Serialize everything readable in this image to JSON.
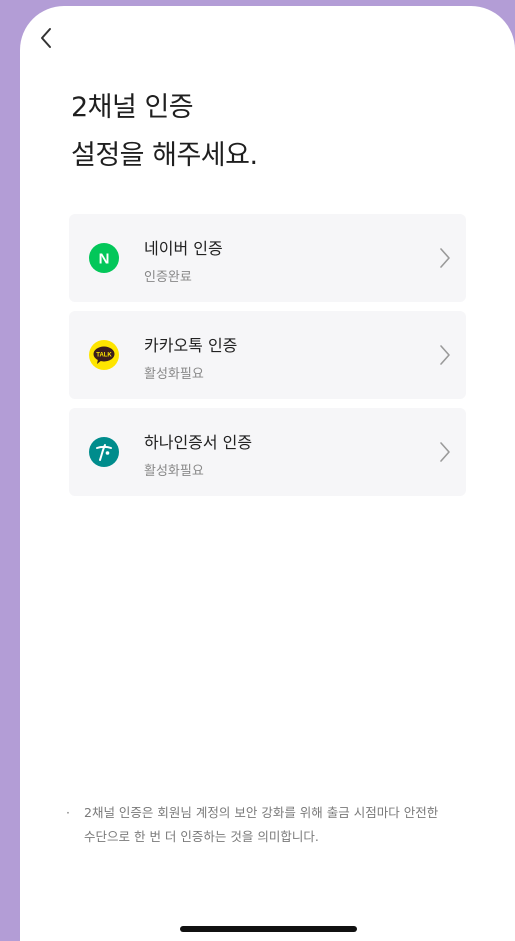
{
  "header": {
    "back_icon": "chevron-left-icon",
    "title_line1": "2채널 인증",
    "title_line2": "설정을 해주세요."
  },
  "auth_methods": [
    {
      "title": "네이버 인증",
      "status": "인증완료",
      "icon": "naver-icon",
      "icon_letter": "N",
      "icon_color": "#03c75a"
    },
    {
      "title": "카카오톡 인증",
      "status": "활성화필요",
      "icon": "kakaotalk-icon",
      "icon_letter": "TALK",
      "icon_color": "#fee500"
    },
    {
      "title": "하나인증서 인증",
      "status": "활성화필요",
      "icon": "hana-icon",
      "icon_color": "#008c8c"
    }
  ],
  "notice": {
    "bullet": "·",
    "text": "2채널 인증은 회원님 계정의 보안 강화를 위해 출금 시점마다 안전한 수단으로 한 번 더 인증하는 것을 의미합니다."
  }
}
